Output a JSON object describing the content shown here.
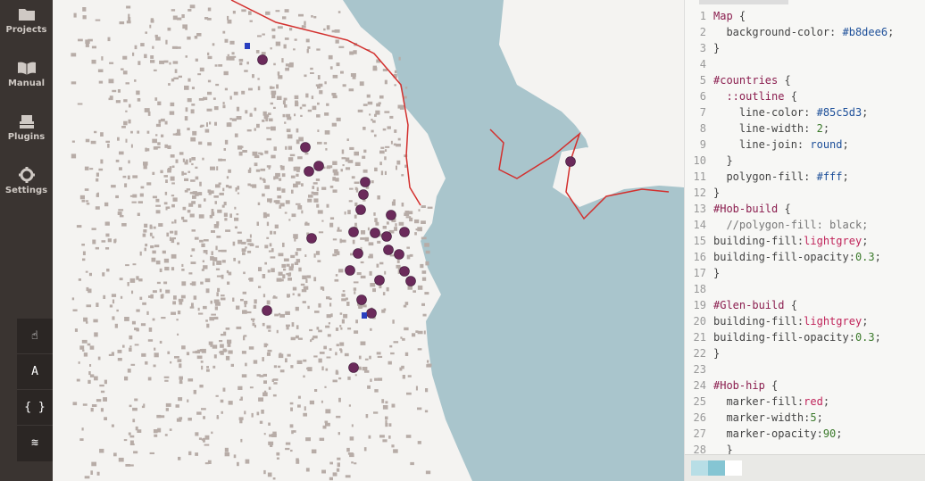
{
  "sidebar": {
    "items": [
      {
        "label": "Projects",
        "icon": "folder-icon"
      },
      {
        "label": "Manual",
        "icon": "book-icon"
      },
      {
        "label": "Plugins",
        "icon": "plugin-icon"
      },
      {
        "label": "Settings",
        "icon": "gear-icon"
      }
    ]
  },
  "tools": [
    {
      "glyph": "☝",
      "icon": "pan-hand-icon"
    },
    {
      "glyph": "A",
      "icon": "font-icon"
    },
    {
      "glyph": "{ }",
      "icon": "code-braces-icon"
    },
    {
      "glyph": "≋",
      "icon": "layers-icon"
    }
  ],
  "colors": {
    "sidebar_bg": "#3a3431",
    "water": "#a9c5cc",
    "land": "#f4f3f1",
    "buildings": "#b7aca7",
    "markers": "#6b2a5b",
    "coastline": "#d3302e",
    "swatch_1": "#b8dee6",
    "swatch_2": "#85c5d3",
    "swatch_3": "#ffffff"
  },
  "editor": {
    "line_numbers": [
      "1",
      "2",
      "3",
      "4",
      "5",
      "6",
      "7",
      "8",
      "9",
      "10",
      "11",
      "12",
      "13",
      "14",
      "15",
      "16",
      "17",
      "18",
      "19",
      "20",
      "21",
      "22",
      "23",
      "24",
      "25",
      "26",
      "27",
      "28"
    ],
    "lines": [
      [
        {
          "t": "Map",
          "c": "sel"
        },
        {
          "t": " {",
          "c": "prop"
        }
      ],
      [
        {
          "t": "  background-color: ",
          "c": "prop"
        },
        {
          "t": "#b8dee6",
          "c": "val"
        },
        {
          "t": ";",
          "c": "prop"
        }
      ],
      [
        {
          "t": "}",
          "c": "prop"
        }
      ],
      [],
      [
        {
          "t": "#countries",
          "c": "sel"
        },
        {
          "t": " {",
          "c": "prop"
        }
      ],
      [
        {
          "t": "  ::outline",
          "c": "sel"
        },
        {
          "t": " {",
          "c": "prop"
        }
      ],
      [
        {
          "t": "    line-color: ",
          "c": "prop"
        },
        {
          "t": "#85c5d3",
          "c": "val"
        },
        {
          "t": ";",
          "c": "prop"
        }
      ],
      [
        {
          "t": "    line-width: ",
          "c": "prop"
        },
        {
          "t": "2",
          "c": "num"
        },
        {
          "t": ";",
          "c": "prop"
        }
      ],
      [
        {
          "t": "    line-join: ",
          "c": "prop"
        },
        {
          "t": "round",
          "c": "val"
        },
        {
          "t": ";",
          "c": "prop"
        }
      ],
      [
        {
          "t": "  }",
          "c": "prop"
        }
      ],
      [
        {
          "t": "  polygon-fill: ",
          "c": "prop"
        },
        {
          "t": "#fff",
          "c": "val"
        },
        {
          "t": ";",
          "c": "prop"
        }
      ],
      [
        {
          "t": "}",
          "c": "prop"
        }
      ],
      [
        {
          "t": "#Hob-build",
          "c": "sel"
        },
        {
          "t": " {",
          "c": "prop"
        }
      ],
      [
        {
          "t": "  //polygon-fill: black;",
          "c": "cmt"
        }
      ],
      [
        {
          "t": "building-fill:",
          "c": "prop"
        },
        {
          "t": "lightgrey",
          "c": "kw"
        },
        {
          "t": ";",
          "c": "prop"
        }
      ],
      [
        {
          "t": "building-fill-opacity:",
          "c": "prop"
        },
        {
          "t": "0.3",
          "c": "num"
        },
        {
          "t": ";",
          "c": "prop"
        }
      ],
      [
        {
          "t": "}",
          "c": "prop"
        }
      ],
      [],
      [
        {
          "t": "#Glen-build",
          "c": "sel"
        },
        {
          "t": " {",
          "c": "prop"
        }
      ],
      [
        {
          "t": "building-fill:",
          "c": "prop"
        },
        {
          "t": "lightgrey",
          "c": "kw"
        },
        {
          "t": ";",
          "c": "prop"
        }
      ],
      [
        {
          "t": "building-fill-opacity:",
          "c": "prop"
        },
        {
          "t": "0.3",
          "c": "num"
        },
        {
          "t": ";",
          "c": "prop"
        }
      ],
      [
        {
          "t": "}",
          "c": "prop"
        }
      ],
      [],
      [
        {
          "t": "#Hob-hip",
          "c": "sel"
        },
        {
          "t": " {",
          "c": "prop"
        }
      ],
      [
        {
          "t": "  marker-fill:",
          "c": "prop"
        },
        {
          "t": "red",
          "c": "kw"
        },
        {
          "t": ";",
          "c": "prop"
        }
      ],
      [
        {
          "t": "  marker-width:",
          "c": "prop"
        },
        {
          "t": "5",
          "c": "num"
        },
        {
          "t": ";",
          "c": "prop"
        }
      ],
      [
        {
          "t": "  marker-opacity:",
          "c": "prop"
        },
        {
          "t": "90",
          "c": "num"
        },
        {
          "t": ";",
          "c": "prop"
        }
      ],
      [
        {
          "t": "  }",
          "c": "prop"
        }
      ]
    ]
  }
}
